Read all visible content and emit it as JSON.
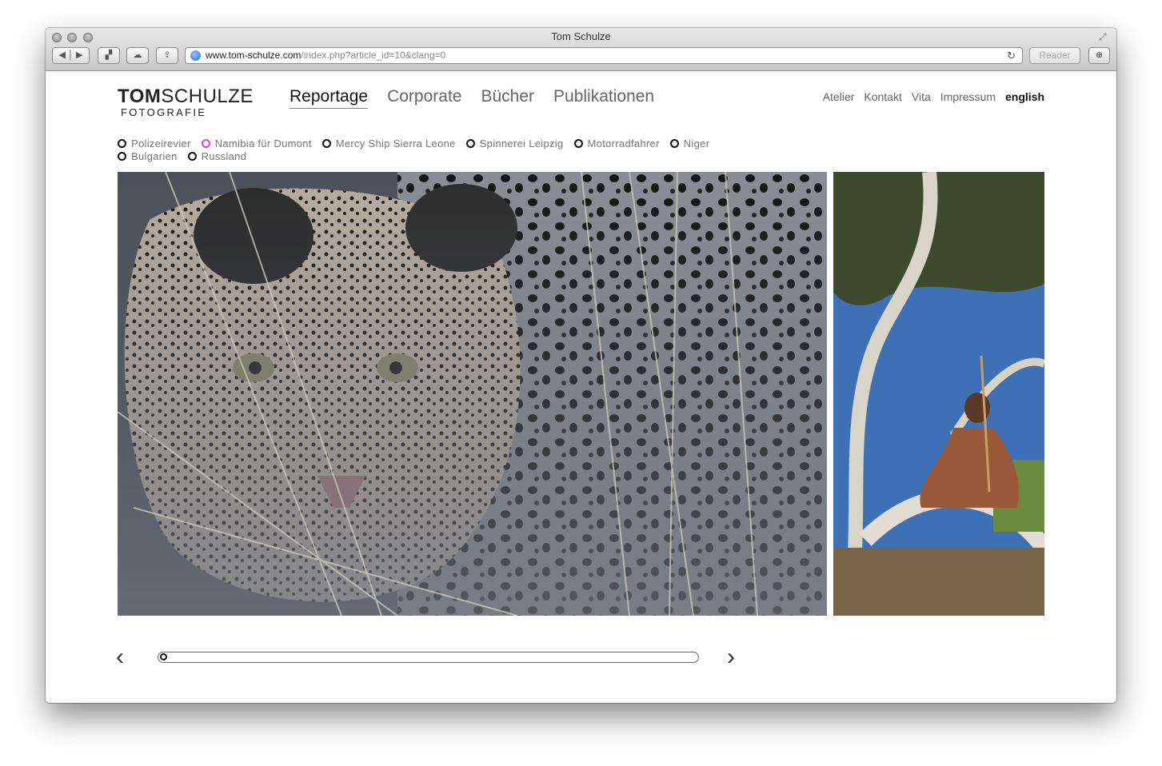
{
  "browser": {
    "title": "Tom Schulze",
    "url_host": "www.tom-schulze.com",
    "url_path": "/index.php?article_id=10&clang=0",
    "reader_label": "Reader"
  },
  "site": {
    "logo_bold": "TOM",
    "logo_light": "SCHULZE",
    "logo_sub": "FOTOGRAFIE"
  },
  "main_nav": [
    "Reportage",
    "Corporate",
    "Bücher",
    "Publikationen"
  ],
  "top_nav": [
    "Atelier",
    "Kontakt",
    "Vita",
    "Impressum"
  ],
  "lang_link": "english",
  "sub_nav": {
    "row1": [
      "Polizeirevier",
      "Namibia für Dumont",
      "Mercy Ship Sierra Leone",
      "Spinnerei Leipzig",
      "Motorradfahrer",
      "Niger"
    ],
    "row2": [
      "Bulgarien",
      "Russland"
    ],
    "active": "Namibia für Dumont"
  },
  "gallery": {
    "slider_position": 0,
    "prev_label": "‹",
    "next_label": "›"
  },
  "colors": {
    "accent": "#e23bd6"
  }
}
